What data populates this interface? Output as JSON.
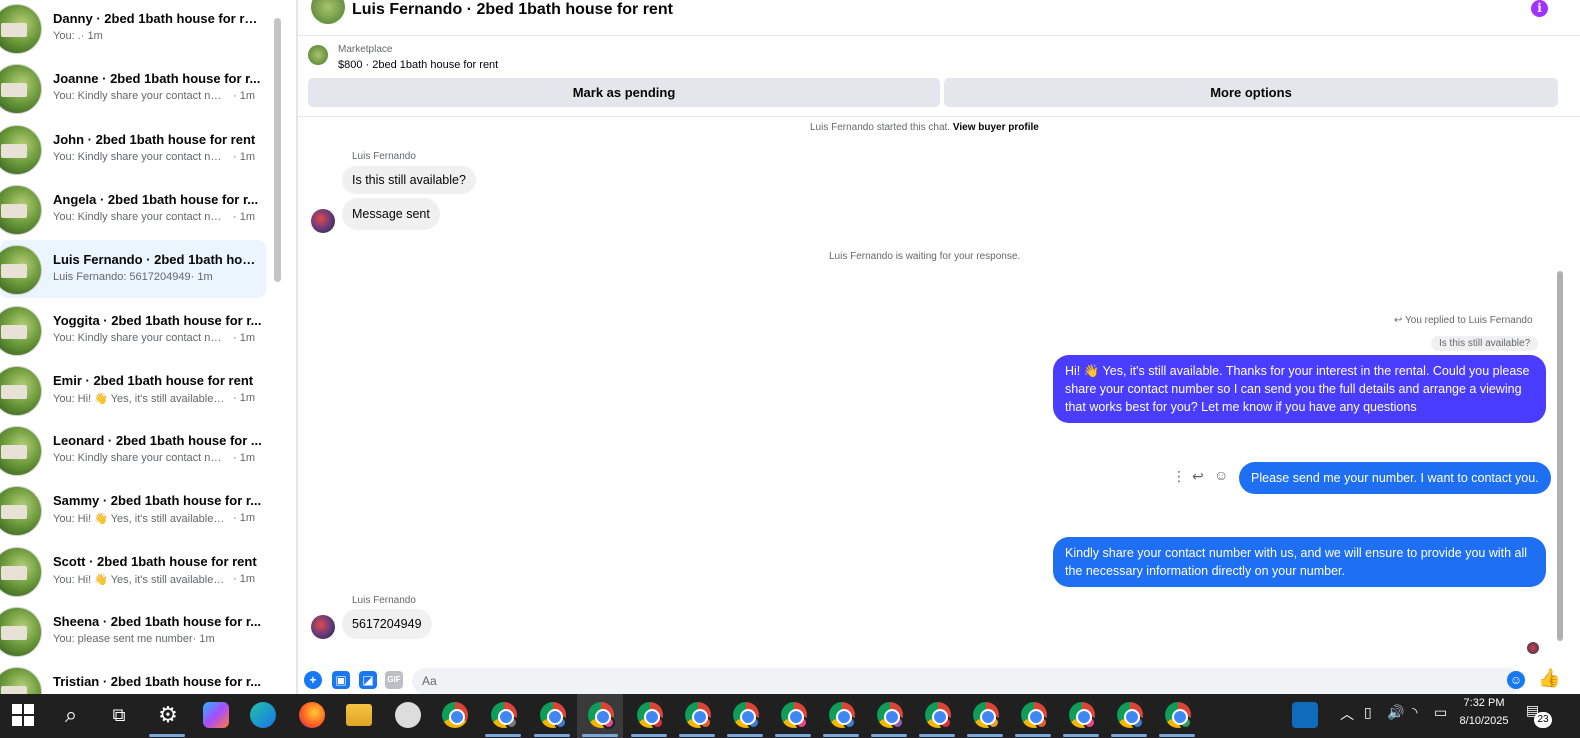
{
  "sidebar": {
    "conversations": [
      {
        "name": "Danny · 2bed 1bath house for rent",
        "preview": "You: .",
        "time": "· 1m",
        "short": true
      },
      {
        "name": "Joanne · 2bed 1bath house for r...",
        "preview": "You: Kindly share your contact nu...",
        "time": "· 1m"
      },
      {
        "name": "John · 2bed 1bath house for rent",
        "preview": "You: Kindly share your contact nu...",
        "time": "· 1m"
      },
      {
        "name": "Angela · 2bed 1bath house for r...",
        "preview": "You: Kindly share your contact nu...",
        "time": "· 1m"
      },
      {
        "name": "Luis Fernando · 2bed 1bath hous...",
        "preview": "Luis Fernando: 5617204949",
        "time": "· 1m",
        "short": true,
        "active": true
      },
      {
        "name": "Yoggita · 2bed 1bath house for r...",
        "preview": "You: Kindly share your contact nu...",
        "time": "· 1m"
      },
      {
        "name": "Emir · 2bed 1bath house for rent",
        "preview": "You: Hi! 👋 Yes, it's still available. T...",
        "time": "· 1m"
      },
      {
        "name": "Leonard · 2bed 1bath house for ...",
        "preview": "You: Kindly share your contact nu...",
        "time": "· 1m"
      },
      {
        "name": "Sammy · 2bed 1bath house for r...",
        "preview": "You: Hi! 👋 Yes, it's still available. T...",
        "time": "· 1m"
      },
      {
        "name": "Scott · 2bed 1bath house for rent",
        "preview": "You: Hi! 👋 Yes, it's still available. T...",
        "time": "· 1m"
      },
      {
        "name": "Sheena · 2bed 1bath house for r...",
        "preview": "You: please sent me number",
        "time": "· 1m",
        "short": true
      },
      {
        "name": "Tristian · 2bed 1bath house for r...",
        "preview": "",
        "time": ""
      }
    ]
  },
  "header": {
    "title": "Luis Fernando · 2bed 1bath house for rent",
    "info_icon": "i"
  },
  "marketplace": {
    "label": "Marketplace",
    "item": "$800 · 2bed 1bath house for rent",
    "mark_pending": "Mark as pending",
    "more_options": "More options"
  },
  "chat": {
    "started_prefix": "Luis Fernando started this chat.",
    "view_profile": "View buyer profile",
    "sender1": "Luis Fernando",
    "msg1": "Is this still available?",
    "msg2": "Message sent",
    "waiting": "Luis Fernando is waiting for your response.",
    "replied_to": "You replied to Luis Fernando",
    "quoted": "Is this still available?",
    "out1": "Hi! 👋 Yes, it's still available. Thanks for your interest in the rental. Could you please share your contact number so I can send you the full details and arrange a viewing that works best for you? Let me know if you have any questions",
    "out2": "Please send me your number. I want to contact you.",
    "out3": "Kindly share your contact number with us, and we will ensure to provide you with all the necessary information directly on your number.",
    "sender2": "Luis Fernando",
    "msg3": "5617204949"
  },
  "composer": {
    "placeholder": "Aa"
  },
  "taskbar": {
    "time": "7:32 PM",
    "date": "8/10/2025",
    "notifications": "23"
  }
}
